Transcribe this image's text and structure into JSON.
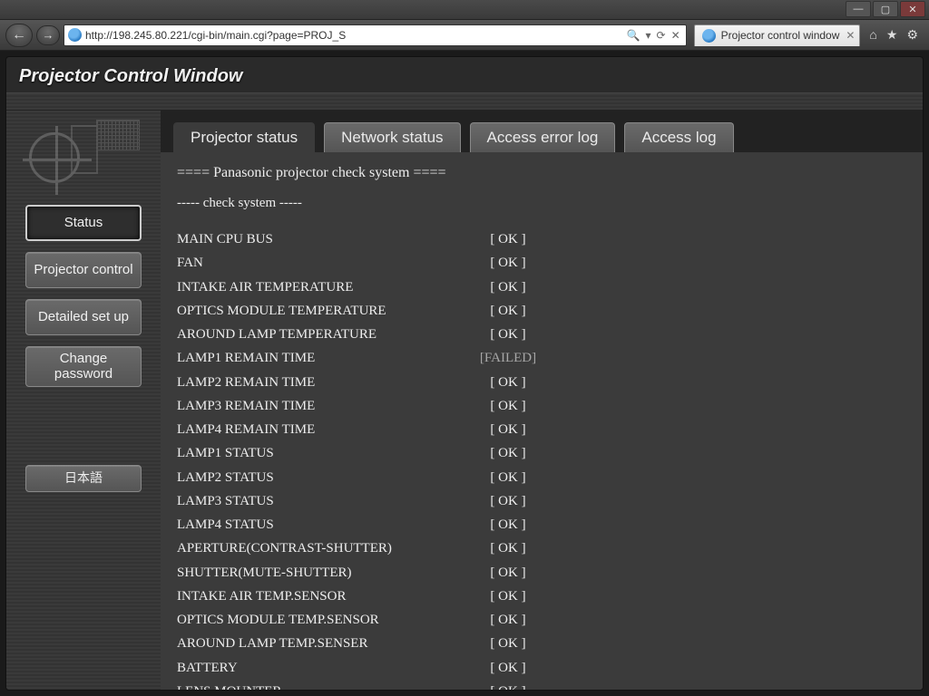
{
  "browser": {
    "url": "http://198.245.80.221/cgi-bin/main.cgi?page=PROJ_S",
    "tab_title": "Projector control window",
    "search_glyph": "🔍"
  },
  "page": {
    "title": "Projector Control Window"
  },
  "sidebar": {
    "items": [
      {
        "label": "Status",
        "active": true
      },
      {
        "label": "Projector control",
        "active": false
      },
      {
        "label": "Detailed set up",
        "active": false
      },
      {
        "label": "Change password",
        "active": false
      }
    ],
    "lang_label": "日本語"
  },
  "tabs": [
    {
      "label": "Projector status",
      "active": true
    },
    {
      "label": "Network status",
      "active": false
    },
    {
      "label": "Access error log",
      "active": false
    },
    {
      "label": "Access log",
      "active": false
    }
  ],
  "content": {
    "header1": "==== Panasonic projector check system ====",
    "header2": "----- check system -----",
    "checks": [
      {
        "label": "MAIN CPU BUS",
        "status": "[ OK ]",
        "failed": false
      },
      {
        "label": "FAN",
        "status": "[ OK ]",
        "failed": false
      },
      {
        "label": "INTAKE AIR TEMPERATURE",
        "status": "[ OK ]",
        "failed": false
      },
      {
        "label": "OPTICS MODULE TEMPERATURE",
        "status": "[ OK ]",
        "failed": false
      },
      {
        "label": "AROUND LAMP TEMPERATURE",
        "status": "[ OK ]",
        "failed": false
      },
      {
        "label": "LAMP1 REMAIN TIME",
        "status": "[FAILED]",
        "failed": true
      },
      {
        "label": "LAMP2 REMAIN TIME",
        "status": "[ OK ]",
        "failed": false
      },
      {
        "label": "LAMP3 REMAIN TIME",
        "status": "[ OK ]",
        "failed": false
      },
      {
        "label": "LAMP4 REMAIN TIME",
        "status": "[ OK ]",
        "failed": false
      },
      {
        "label": "LAMP1 STATUS",
        "status": "[ OK ]",
        "failed": false
      },
      {
        "label": "LAMP2 STATUS",
        "status": "[ OK ]",
        "failed": false
      },
      {
        "label": "LAMP3 STATUS",
        "status": "[ OK ]",
        "failed": false
      },
      {
        "label": "LAMP4 STATUS",
        "status": "[ OK ]",
        "failed": false
      },
      {
        "label": "APERTURE(CONTRAST-SHUTTER)",
        "status": "[ OK ]",
        "failed": false
      },
      {
        "label": "SHUTTER(MUTE-SHUTTER)",
        "status": "[ OK ]",
        "failed": false
      },
      {
        "label": "INTAKE AIR TEMP.SENSOR",
        "status": "[ OK ]",
        "failed": false
      },
      {
        "label": "OPTICS MODULE TEMP.SENSOR",
        "status": "[ OK ]",
        "failed": false
      },
      {
        "label": "AROUND LAMP TEMP.SENSER",
        "status": "[ OK ]",
        "failed": false
      },
      {
        "label": "BATTERY",
        "status": "[ OK ]",
        "failed": false
      },
      {
        "label": "LENS MOUNTER",
        "status": "[ OK ]",
        "failed": false
      }
    ]
  }
}
